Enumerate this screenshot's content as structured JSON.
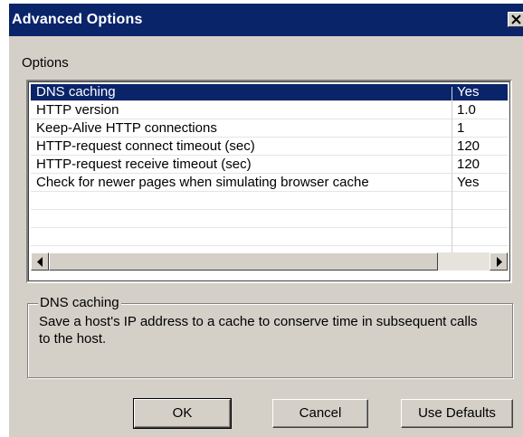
{
  "window": {
    "title": "Advanced Options"
  },
  "options_label": "Options",
  "list": {
    "rows": [
      {
        "name": "DNS caching",
        "value": "Yes",
        "selected": true
      },
      {
        "name": "HTTP version",
        "value": "1.0",
        "selected": false
      },
      {
        "name": "Keep-Alive HTTP connections",
        "value": "1",
        "selected": false
      },
      {
        "name": "HTTP-request connect timeout (sec)",
        "value": "120",
        "selected": false
      },
      {
        "name": "HTTP-request receive timeout (sec)",
        "value": "120",
        "selected": false
      },
      {
        "name": "Check for newer pages when simulating browser cache",
        "value": "Yes",
        "selected": false
      },
      {
        "name": "",
        "value": "",
        "selected": false
      },
      {
        "name": "",
        "value": "",
        "selected": false
      },
      {
        "name": "",
        "value": "",
        "selected": false
      }
    ]
  },
  "description": {
    "title": "DNS caching",
    "text": "Save a host's IP address to a cache to conserve time in subsequent calls to the host."
  },
  "buttons": {
    "ok": "OK",
    "cancel": "Cancel",
    "use_defaults": "Use Defaults"
  },
  "colors": {
    "title_bar": "#0a246a",
    "dialog_face": "#d4d0c8",
    "selection": "#0a246a"
  },
  "icons": {
    "close": "close-icon",
    "scroll_left": "arrow-left-icon",
    "scroll_right": "arrow-right-icon"
  }
}
